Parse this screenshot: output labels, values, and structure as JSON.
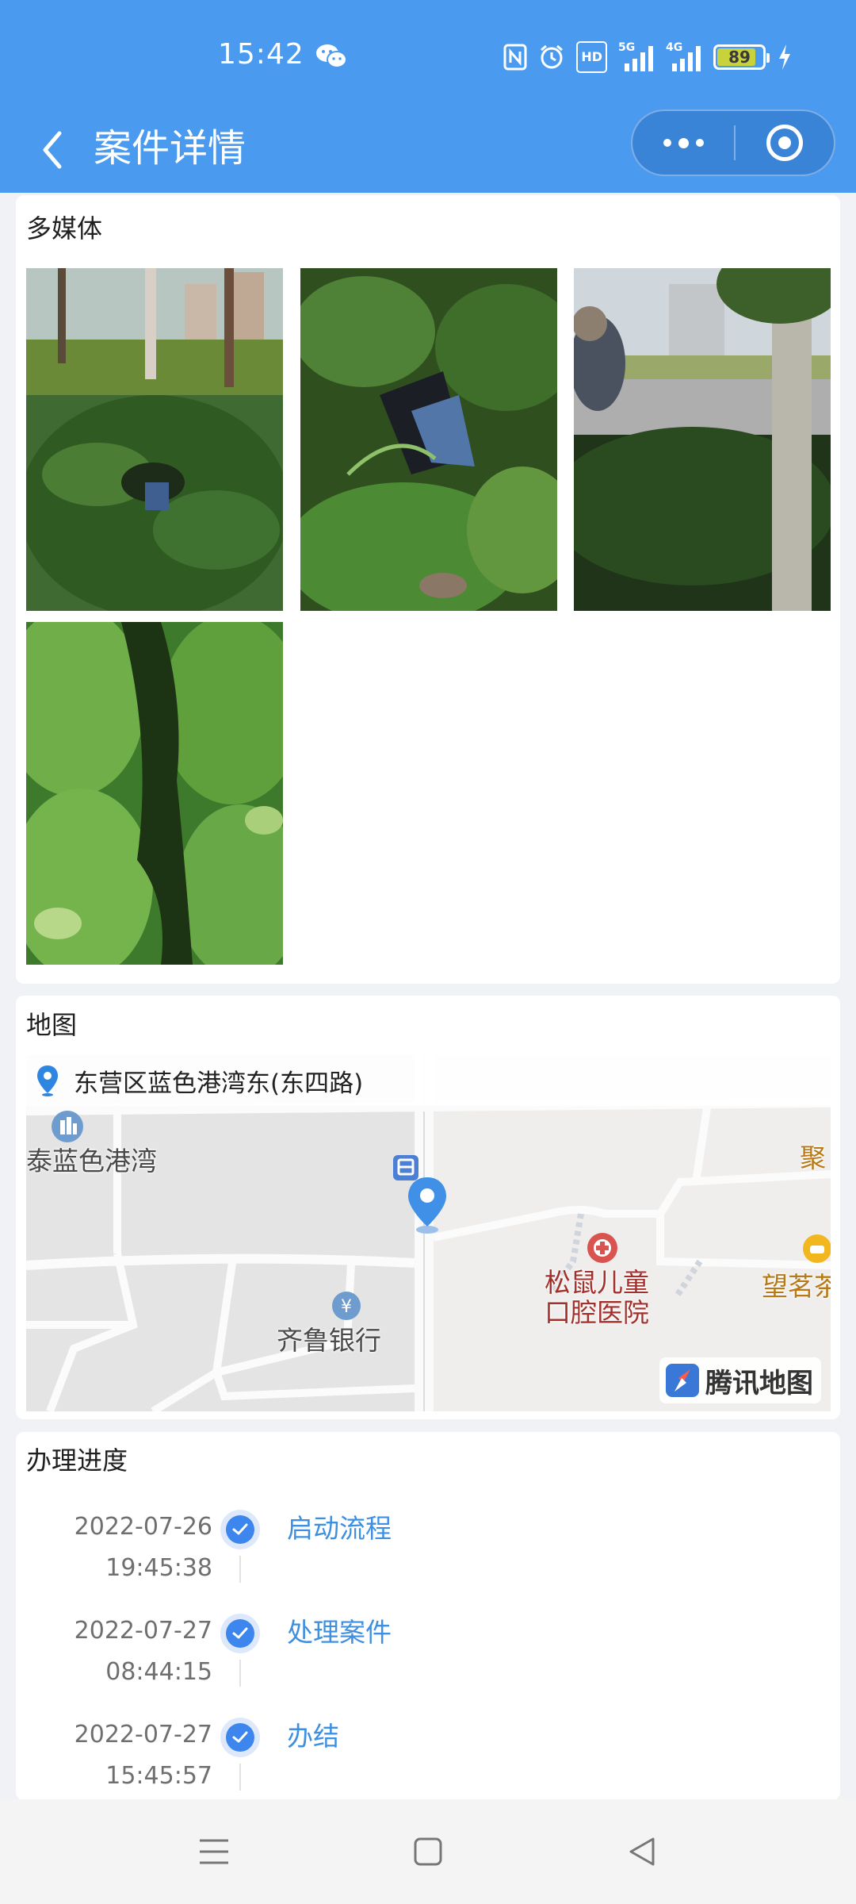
{
  "status_bar": {
    "time": "15:42",
    "battery": "89",
    "icons": [
      "wechat-icon",
      "nfc-icon",
      "alarm-icon",
      "hd-icon",
      "signal-5g-icon",
      "signal-4g-icon",
      "battery-icon",
      "charging-icon"
    ],
    "network_labels": [
      "HD",
      "5G",
      "4G"
    ]
  },
  "nav": {
    "title": "案件详情"
  },
  "media": {
    "title": "多媒体",
    "photos": [
      "photo-1",
      "photo-2",
      "photo-3",
      "photo-4"
    ]
  },
  "map": {
    "title": "地图",
    "address": "东营区蓝色港湾东(东四路)",
    "pois": {
      "poi1": "泰蓝色港湾",
      "poi2": "齐鲁银行",
      "poi3_line1": "松鼠儿童",
      "poi3_line2": "口腔医院",
      "poi4": "望茗茶",
      "poi5": "聚"
    },
    "logo": "腾讯地图"
  },
  "progress": {
    "title": "办理进度",
    "steps": [
      {
        "date": "2022-07-26",
        "time": "19:45:38",
        "label": "启动流程"
      },
      {
        "date": "2022-07-27",
        "time": "08:44:15",
        "label": "处理案件"
      },
      {
        "date": "2022-07-27",
        "time": "15:45:57",
        "label": "办结"
      }
    ]
  },
  "colors": {
    "header": "#4a9bf0",
    "accent": "#3c86ee",
    "link": "#3f8fe0",
    "page_bg": "#f0f2f5"
  }
}
